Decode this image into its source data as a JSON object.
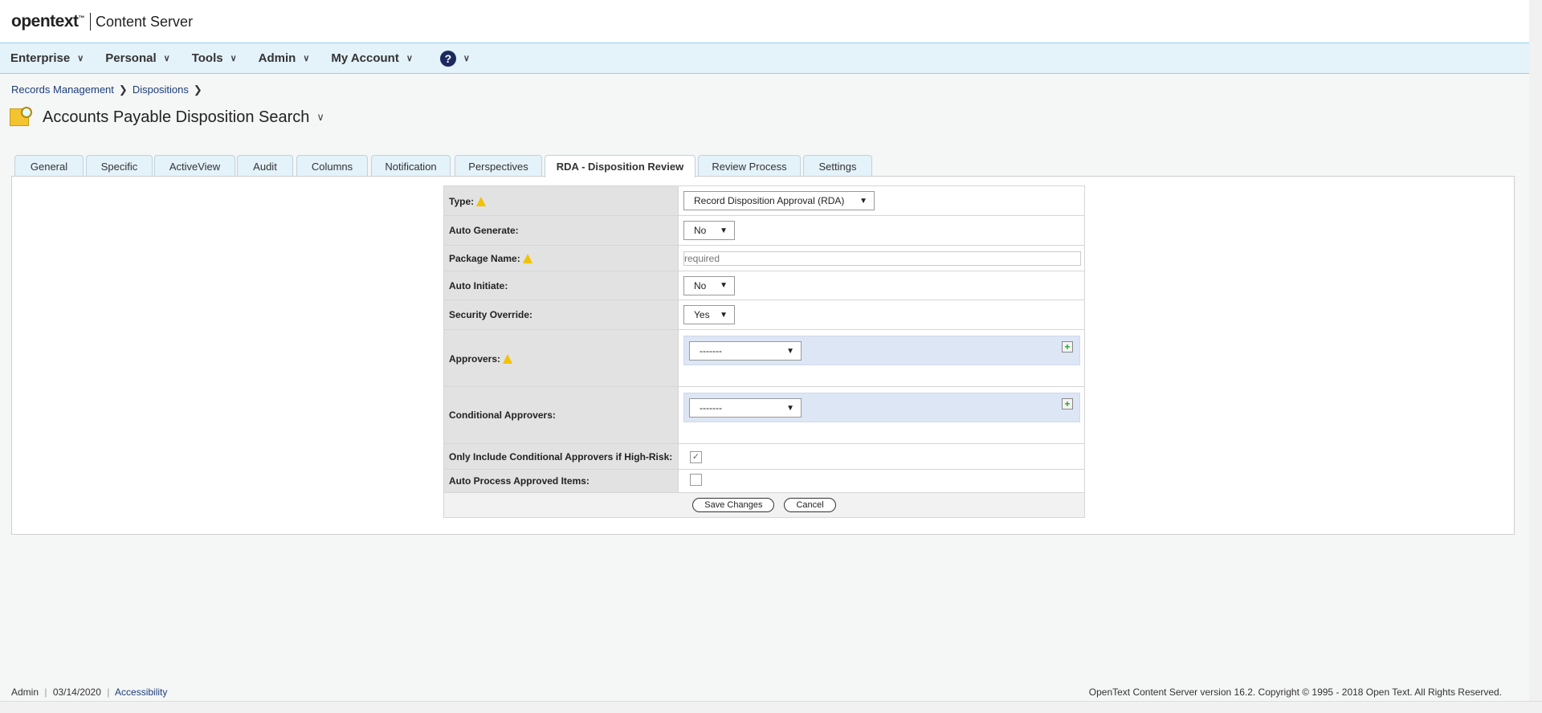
{
  "header": {
    "logo": "opentext",
    "product": "Content Server"
  },
  "nav": {
    "items": [
      "Enterprise",
      "Personal",
      "Tools",
      "Admin",
      "My Account"
    ],
    "help_icon": "help-circle-icon"
  },
  "breadcrumb": [
    "Records Management",
    "Dispositions"
  ],
  "page": {
    "title": "Accounts Payable Disposition Search"
  },
  "tabs": [
    "General",
    "Specific",
    "ActiveView",
    "Audit",
    "Columns",
    "Notification",
    "Perspectives",
    "RDA - Disposition Review",
    "Review Process",
    "Settings"
  ],
  "active_tab": "RDA - Disposition Review",
  "form": {
    "type_label": "Type:",
    "type_value": "Record Disposition Approval (RDA)",
    "auto_generate_label": "Auto Generate:",
    "auto_generate_value": "No",
    "package_name_label": "Package Name:",
    "package_name_placeholder": "required",
    "auto_initiate_label": "Auto Initiate:",
    "auto_initiate_value": "No",
    "security_override_label": "Security Override:",
    "security_override_value": "Yes",
    "approvers_label": "Approvers:",
    "approvers_value": "-------",
    "conditional_label": "Conditional Approvers:",
    "conditional_value": "-------",
    "high_risk_label": "Only Include Conditional Approvers if High-Risk:",
    "high_risk_checked": true,
    "auto_process_label": "Auto Process Approved Items:",
    "auto_process_checked": false,
    "save": "Save Changes",
    "cancel": "Cancel"
  },
  "footer": {
    "user": "Admin",
    "date": "03/14/2020",
    "accessibility": "Accessibility",
    "copyright": "OpenText Content Server version 16.2. Copyright © 1995 - 2018 Open Text. All Rights Reserved."
  }
}
